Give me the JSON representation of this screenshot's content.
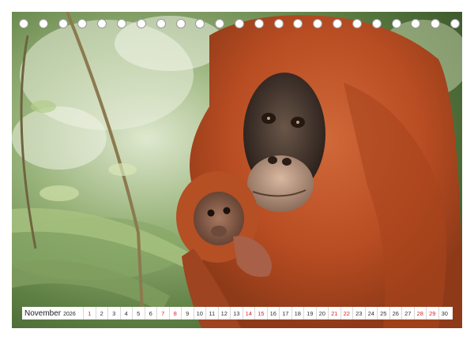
{
  "calendar": {
    "month": "November",
    "year": "2026",
    "days": [
      "1",
      "2",
      "3",
      "4",
      "5",
      "6",
      "7",
      "8",
      "9",
      "10",
      "11",
      "12",
      "13",
      "14",
      "15",
      "16",
      "17",
      "18",
      "19",
      "20",
      "21",
      "22",
      "23",
      "24",
      "25",
      "26",
      "27",
      "28",
      "29",
      "30"
    ],
    "sundays": [
      "1",
      "8",
      "15",
      "22",
      "29"
    ],
    "saturday_red": [
      "7",
      "14",
      "21",
      "28"
    ]
  },
  "photo": {
    "subject": "orangutan-mother-and-baby",
    "colors": {
      "fur": "#c0562a",
      "face": "#4a3a30",
      "foliage": "#7f9e5e",
      "highlight": "#eef2e4"
    }
  },
  "binding": {
    "ring_count": 23
  }
}
